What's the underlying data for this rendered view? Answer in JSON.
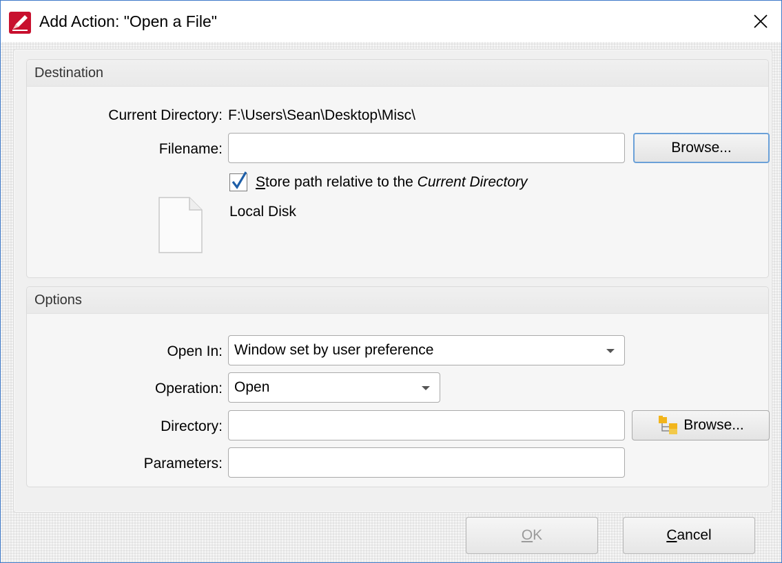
{
  "window": {
    "title": "Add Action: \"Open a File\"",
    "accent": "#3c78c8"
  },
  "destination": {
    "header": "Destination",
    "current_dir_label": "Current Directory:",
    "current_dir_value": "F:\\Users\\Sean\\Desktop\\Misc\\",
    "filename_label": "Filename:",
    "filename_value": "",
    "browse_label": "Browse...",
    "store_path_checked": true,
    "store_path_ul": "S",
    "store_path_rest": "tore path relative to the ",
    "store_path_italic": "Current Directory",
    "file_type": "Local Disk"
  },
  "options": {
    "header": "Options",
    "open_in_label": "Open In:",
    "open_in_value": "Window set by user preference",
    "operation_label": "Operation:",
    "operation_value": "Open",
    "directory_label": "Directory:",
    "directory_value": "",
    "directory_browse_label": "Browse...",
    "parameters_label": "Parameters:",
    "parameters_value": ""
  },
  "footer": {
    "ok_ul": "O",
    "ok_rest": "K",
    "ok_enabled": false,
    "cancel_ul": "C",
    "cancel_rest": "ancel"
  },
  "icons": {
    "app": "pdf-editor-icon",
    "close": "close-icon",
    "checkmark": "checkmark-icon",
    "file": "blank-file-icon",
    "folder": "folder-tree-icon"
  }
}
